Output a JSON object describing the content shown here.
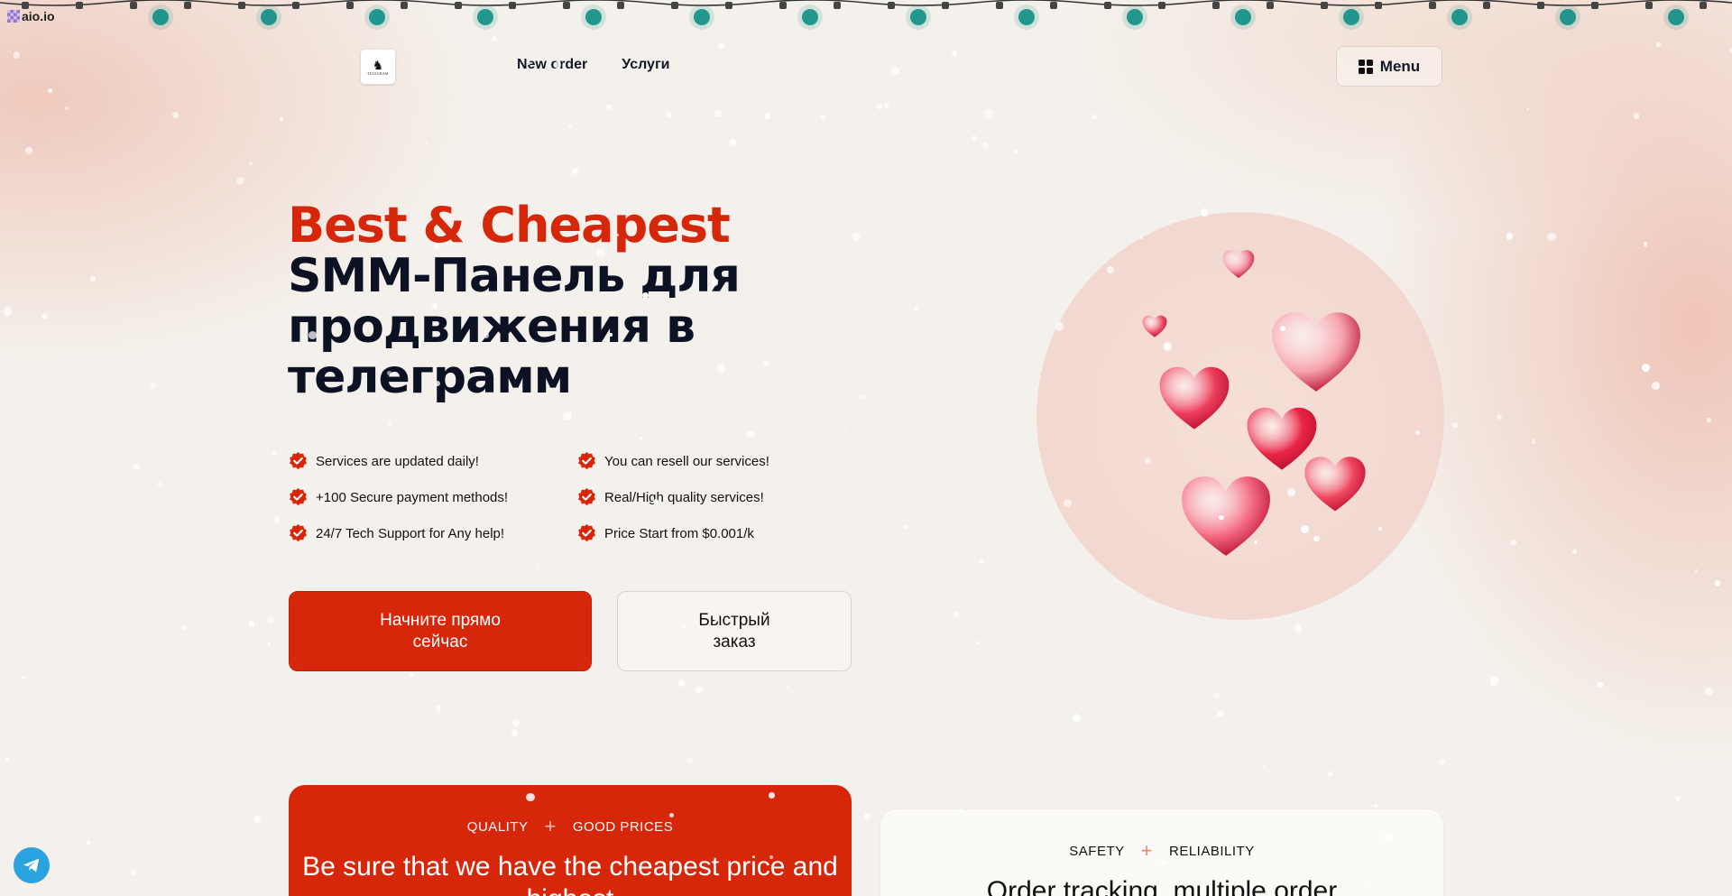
{
  "brand_tag": "aio.io",
  "header": {
    "logo_text": "TELEGRAM",
    "nav": [
      "New order",
      "Услуги"
    ],
    "menu_label": "Menu"
  },
  "hero": {
    "title_accent": "Best & Cheapest",
    "title_rest": "SMM-Панель для продвижения в телеграмм"
  },
  "features": [
    "Services are updated daily!",
    "You can resell our services!",
    "+100 Secure payment methods!",
    "Real/High quality services!",
    "24/7 Tech Support for Any help!",
    "Price Start from $0.001/k"
  ],
  "buttons": {
    "primary": "Начните прямо сейчас",
    "secondary": "Быстрый заказ"
  },
  "card_quality": {
    "tag1": "QUALITY",
    "tag2": "GOOD PRICES",
    "title": "Be sure that we have the cheapest price and highest"
  },
  "card_safety": {
    "tag1": "SAFETY",
    "tag2": "RELIABILITY",
    "title": "Order tracking, multiple order"
  },
  "icons": {
    "menu": "grid-icon",
    "feature": "check-badge-icon",
    "telegram": "telegram-icon",
    "plus": "plus-icon"
  },
  "colors": {
    "accent": "#d6270b",
    "dark_text": "#0c1224",
    "background": "#f4f1ec",
    "light_teal": "#0e8f86",
    "telegram": "#2aa3e0"
  }
}
